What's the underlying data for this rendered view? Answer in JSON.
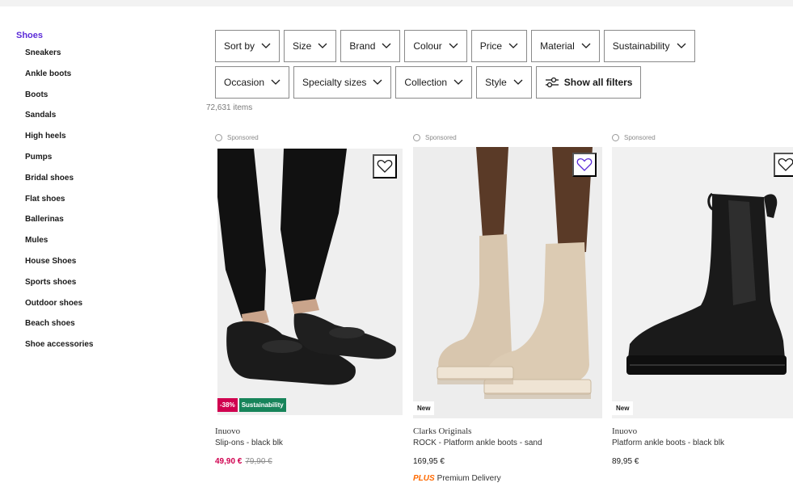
{
  "sidebar": {
    "title": "Shoes",
    "items": [
      "Sneakers",
      "Ankle boots",
      "Boots",
      "Sandals",
      "High heels",
      "Pumps",
      "Bridal shoes",
      "Flat shoes",
      "Ballerinas",
      "Mules",
      "House Shoes",
      "Sports shoes",
      "Outdoor shoes",
      "Beach shoes",
      "Shoe accessories"
    ]
  },
  "filters": {
    "row1": [
      "Sort by",
      "Size",
      "Brand",
      "Colour",
      "Price",
      "Material",
      "Sustainability"
    ],
    "row2": [
      "Occasion",
      "Specialty sizes",
      "Collection",
      "Style"
    ],
    "show_all": "Show all filters"
  },
  "items_count": "72,631 items",
  "products": [
    {
      "sponsored": "Sponsored",
      "brand": "Inuovo",
      "name": "Slip-ons - black blk",
      "price": "49,90 €",
      "old_price": "79,90 €",
      "badges": [
        "-38%",
        "Sustainability"
      ]
    },
    {
      "sponsored": "Sponsored",
      "brand": "Clarks Originals",
      "name": "ROCK - Platform ankle boots - sand",
      "price": "169,95 €",
      "badge_new": "New",
      "plus_logo": "PLUS",
      "plus_text": "Premium Delivery"
    },
    {
      "sponsored": "Sponsored",
      "brand": "Inuovo",
      "name": "Platform ankle boots - black blk",
      "price": "89,95 €",
      "badge_new": "New"
    }
  ],
  "colors": {
    "accent": "#5b2bd8",
    "sale": "#d0004f",
    "sustainability": "#17845a",
    "plus": "#ff6900"
  }
}
